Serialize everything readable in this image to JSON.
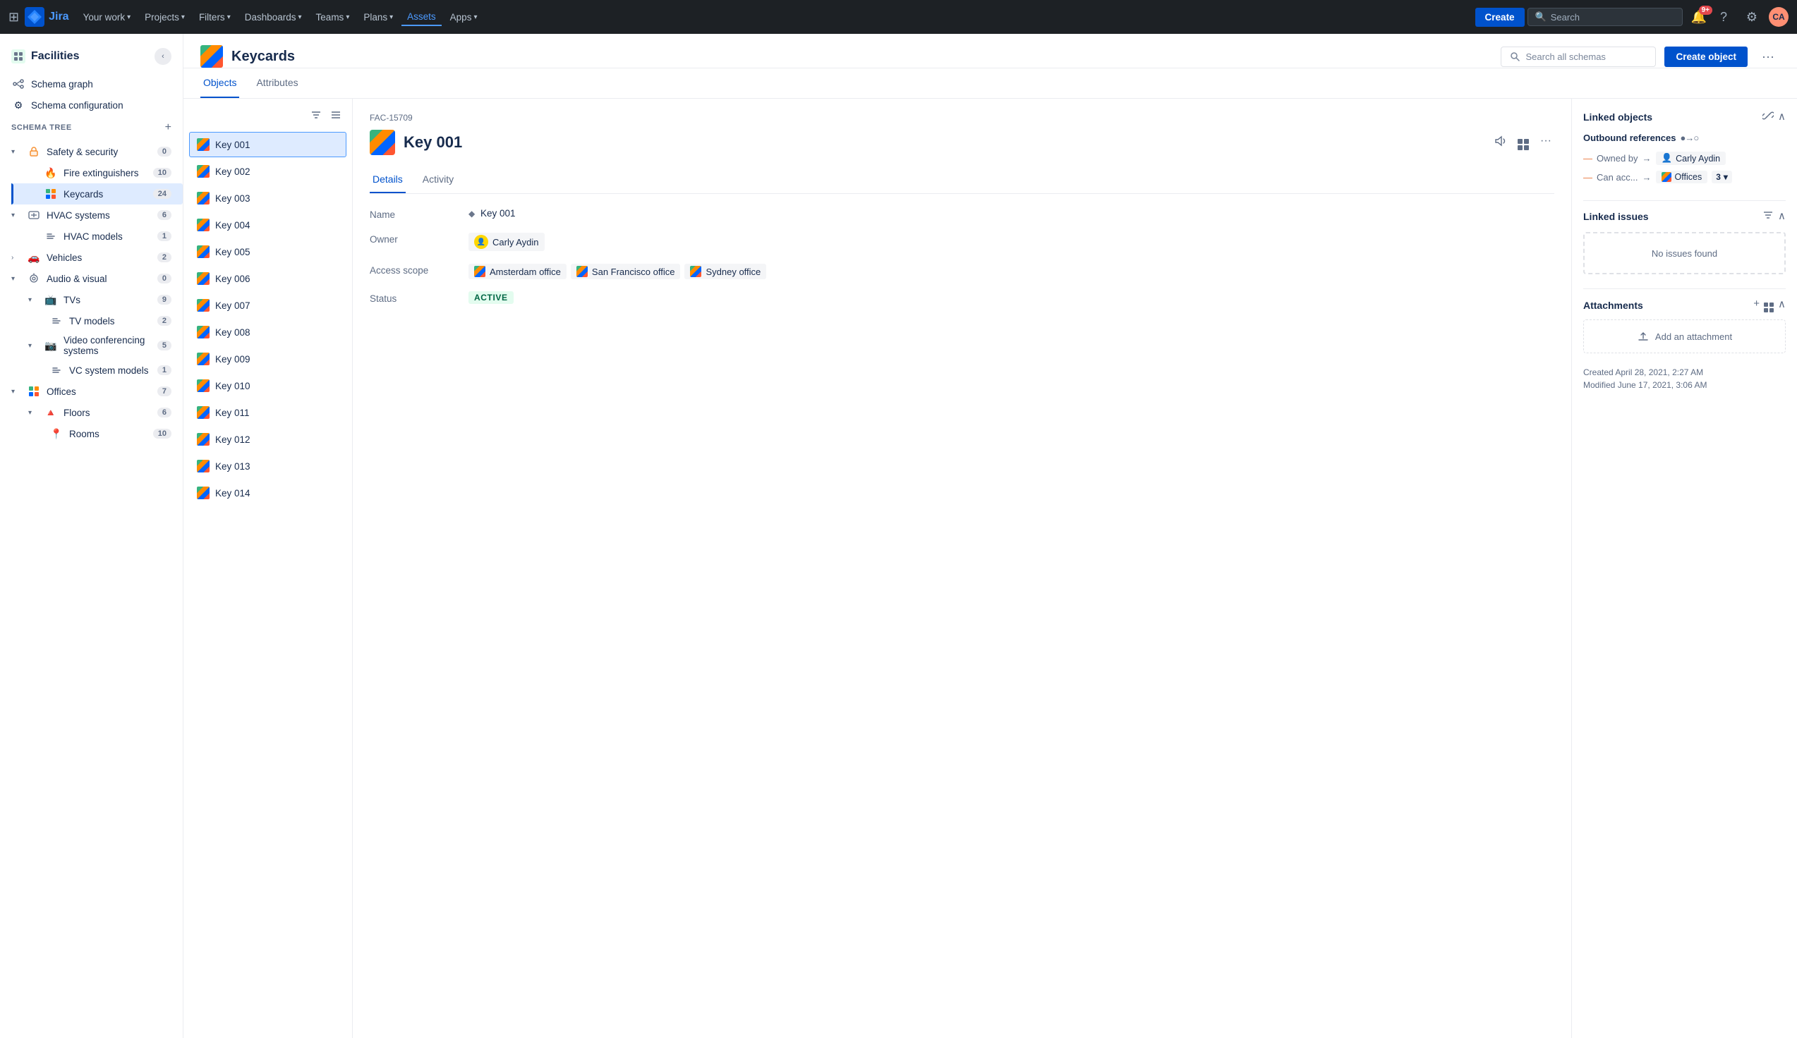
{
  "topnav": {
    "logo_text": "Jira",
    "links": [
      {
        "label": "Your work",
        "has_chevron": true
      },
      {
        "label": "Projects",
        "has_chevron": true
      },
      {
        "label": "Filters",
        "has_chevron": true
      },
      {
        "label": "Dashboards",
        "has_chevron": true
      },
      {
        "label": "Teams",
        "has_chevron": true
      },
      {
        "label": "Plans",
        "has_chevron": true
      },
      {
        "label": "Assets",
        "has_chevron": false
      },
      {
        "label": "Apps",
        "has_chevron": true
      }
    ],
    "create_label": "Create",
    "search_placeholder": "Search",
    "notification_count": "9+",
    "avatar_initials": "CA"
  },
  "sidebar": {
    "title": "Facilities",
    "nav_items": [
      {
        "label": "Schema graph",
        "icon": "graph"
      },
      {
        "label": "Schema configuration",
        "icon": "gear"
      }
    ],
    "schema_tree_label": "SCHEMA TREE",
    "tree": [
      {
        "label": "Safety & security",
        "icon": "lock",
        "count": 0,
        "expanded": true,
        "children": [
          {
            "label": "Fire extinguishers",
            "icon": "fire",
            "count": 10,
            "children": []
          },
          {
            "label": "Keycards",
            "icon": "grid",
            "count": 24,
            "active": true,
            "children": []
          }
        ]
      },
      {
        "label": "HVAC systems",
        "icon": "hvac",
        "count": 6,
        "expanded": true,
        "children": [
          {
            "label": "HVAC models",
            "icon": "list",
            "count": 1,
            "children": []
          }
        ]
      },
      {
        "label": "Vehicles",
        "icon": "vehicle",
        "count": 2,
        "expanded": false,
        "children": []
      },
      {
        "label": "Audio & visual",
        "icon": "av",
        "count": 0,
        "expanded": true,
        "children": [
          {
            "label": "TVs",
            "icon": "tv",
            "count": 9,
            "expanded": true,
            "children": [
              {
                "label": "TV models",
                "icon": "list",
                "count": 2,
                "children": []
              }
            ]
          },
          {
            "label": "Video conferencing systems",
            "icon": "vcam",
            "count": 5,
            "expanded": true,
            "children": [
              {
                "label": "VC system models",
                "icon": "list",
                "count": 1,
                "children": []
              }
            ]
          }
        ]
      },
      {
        "label": "Offices",
        "icon": "offices",
        "count": 7,
        "expanded": true,
        "children": [
          {
            "label": "Floors",
            "icon": "floors",
            "count": 6,
            "expanded": true,
            "children": [
              {
                "label": "Rooms",
                "icon": "rooms",
                "count": 10,
                "children": []
              }
            ]
          }
        ]
      }
    ]
  },
  "main": {
    "header_icon_alt": "Keycards icon",
    "title": "Keycards",
    "search_placeholder": "Search all schemas",
    "create_object_label": "Create object",
    "tabs": [
      {
        "label": "Objects",
        "active": true
      },
      {
        "label": "Attributes",
        "active": false
      }
    ]
  },
  "list": {
    "items": [
      {
        "label": "Key 001",
        "selected": true
      },
      {
        "label": "Key 002"
      },
      {
        "label": "Key 003"
      },
      {
        "label": "Key 004"
      },
      {
        "label": "Key 005"
      },
      {
        "label": "Key 006"
      },
      {
        "label": "Key 007"
      },
      {
        "label": "Key 008"
      },
      {
        "label": "Key 009"
      },
      {
        "label": "Key 010"
      },
      {
        "label": "Key 011"
      },
      {
        "label": "Key 012"
      },
      {
        "label": "Key 013"
      },
      {
        "label": "Key 014"
      }
    ]
  },
  "detail": {
    "id": "FAC-15709",
    "title": "Key 001",
    "tabs": [
      {
        "label": "Details",
        "active": true
      },
      {
        "label": "Activity",
        "active": false
      }
    ],
    "fields": {
      "name_label": "Name",
      "name_value": "Key 001",
      "owner_label": "Owner",
      "owner_name": "Carly Aydin",
      "access_scope_label": "Access scope",
      "access_scope_tags": [
        {
          "label": "Amsterdam office"
        },
        {
          "label": "San Francisco office"
        },
        {
          "label": "Sydney office"
        }
      ],
      "status_label": "Status",
      "status_value": "ACTIVE"
    }
  },
  "right_panel": {
    "linked_objects_title": "Linked objects",
    "outbound_label": "Outbound references",
    "linked_rows": [
      {
        "key": "Owned by",
        "value": "Carly Aydin",
        "type": "person"
      },
      {
        "key": "Can acc...",
        "value": "Offices",
        "count": "3",
        "type": "offices"
      }
    ],
    "linked_issues_title": "Linked issues",
    "no_issues_text": "No issues found",
    "attachments_title": "Attachments",
    "add_attachment_text": "Add an attachment",
    "created_label": "Created April 28, 2021, 2:27 AM",
    "modified_label": "Modified June 17, 2021, 3:06 AM"
  }
}
